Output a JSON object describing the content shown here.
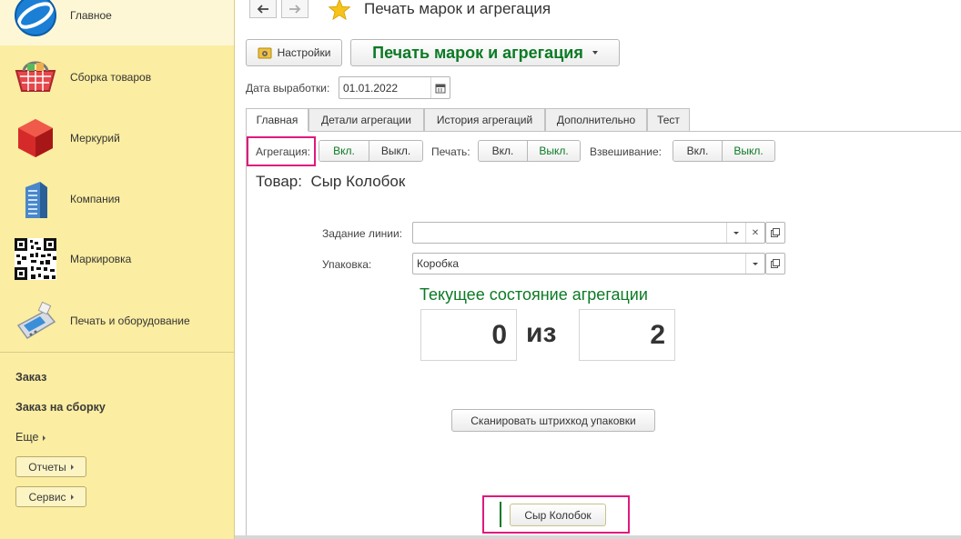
{
  "sidebar": {
    "items": [
      {
        "label": "Главное",
        "icon": "globe-icon"
      },
      {
        "label": "Сборка товаров",
        "icon": "basket-icon"
      },
      {
        "label": "Меркурий",
        "icon": "cube-icon"
      },
      {
        "label": "Компания",
        "icon": "building-icon"
      },
      {
        "label": "Маркировка",
        "icon": "qr-code-icon"
      },
      {
        "label": "Печать и оборудование",
        "icon": "terminal-icon"
      }
    ],
    "links": [
      "Заказ",
      "Заказ на сборку"
    ],
    "more": "Еще",
    "buttons": [
      "Отчеты",
      "Сервис"
    ]
  },
  "header": {
    "title": "Печать марок и агрегация",
    "back_icon": "arrow-left-icon",
    "forward_icon": "arrow-right-icon",
    "favorite_icon": "star-icon"
  },
  "toolbar": {
    "settings_label": "Настройки",
    "settings_icon": "settings-gear-icon",
    "mode_label": "Печать марок и агрегация"
  },
  "production_date": {
    "label": "Дата выработки:",
    "value": "01.01.2022",
    "icon": "calendar-icon"
  },
  "tabs": [
    "Главная",
    "Детали агрегации",
    "История агрегаций",
    "Дополнительно",
    "Тест"
  ],
  "toggles": [
    {
      "label": "Агрегация:",
      "on": "Вкл.",
      "off": "Выкл."
    },
    {
      "label": "Печать:",
      "on": "Вкл.",
      "off": "Выкл."
    },
    {
      "label": "Взвешивание:",
      "on": "Вкл.",
      "off": "Выкл."
    }
  ],
  "product": {
    "label": "Товар:",
    "name": "Сыр Колобок"
  },
  "line_task": {
    "label": "Задание линии:",
    "value": ""
  },
  "packaging": {
    "label": "Упаковка:",
    "value": "Коробка"
  },
  "state": {
    "title": "Текущее состояние агрегации",
    "current": "0",
    "of": "из",
    "total": "2"
  },
  "scan_button": "Сканировать штрихкод упаковки",
  "product_button": "Сыр Колобок",
  "colors": {
    "sidebar_bg": "#fbeda1",
    "accent_green": "#0b7a24",
    "highlight": "#e0197d"
  }
}
